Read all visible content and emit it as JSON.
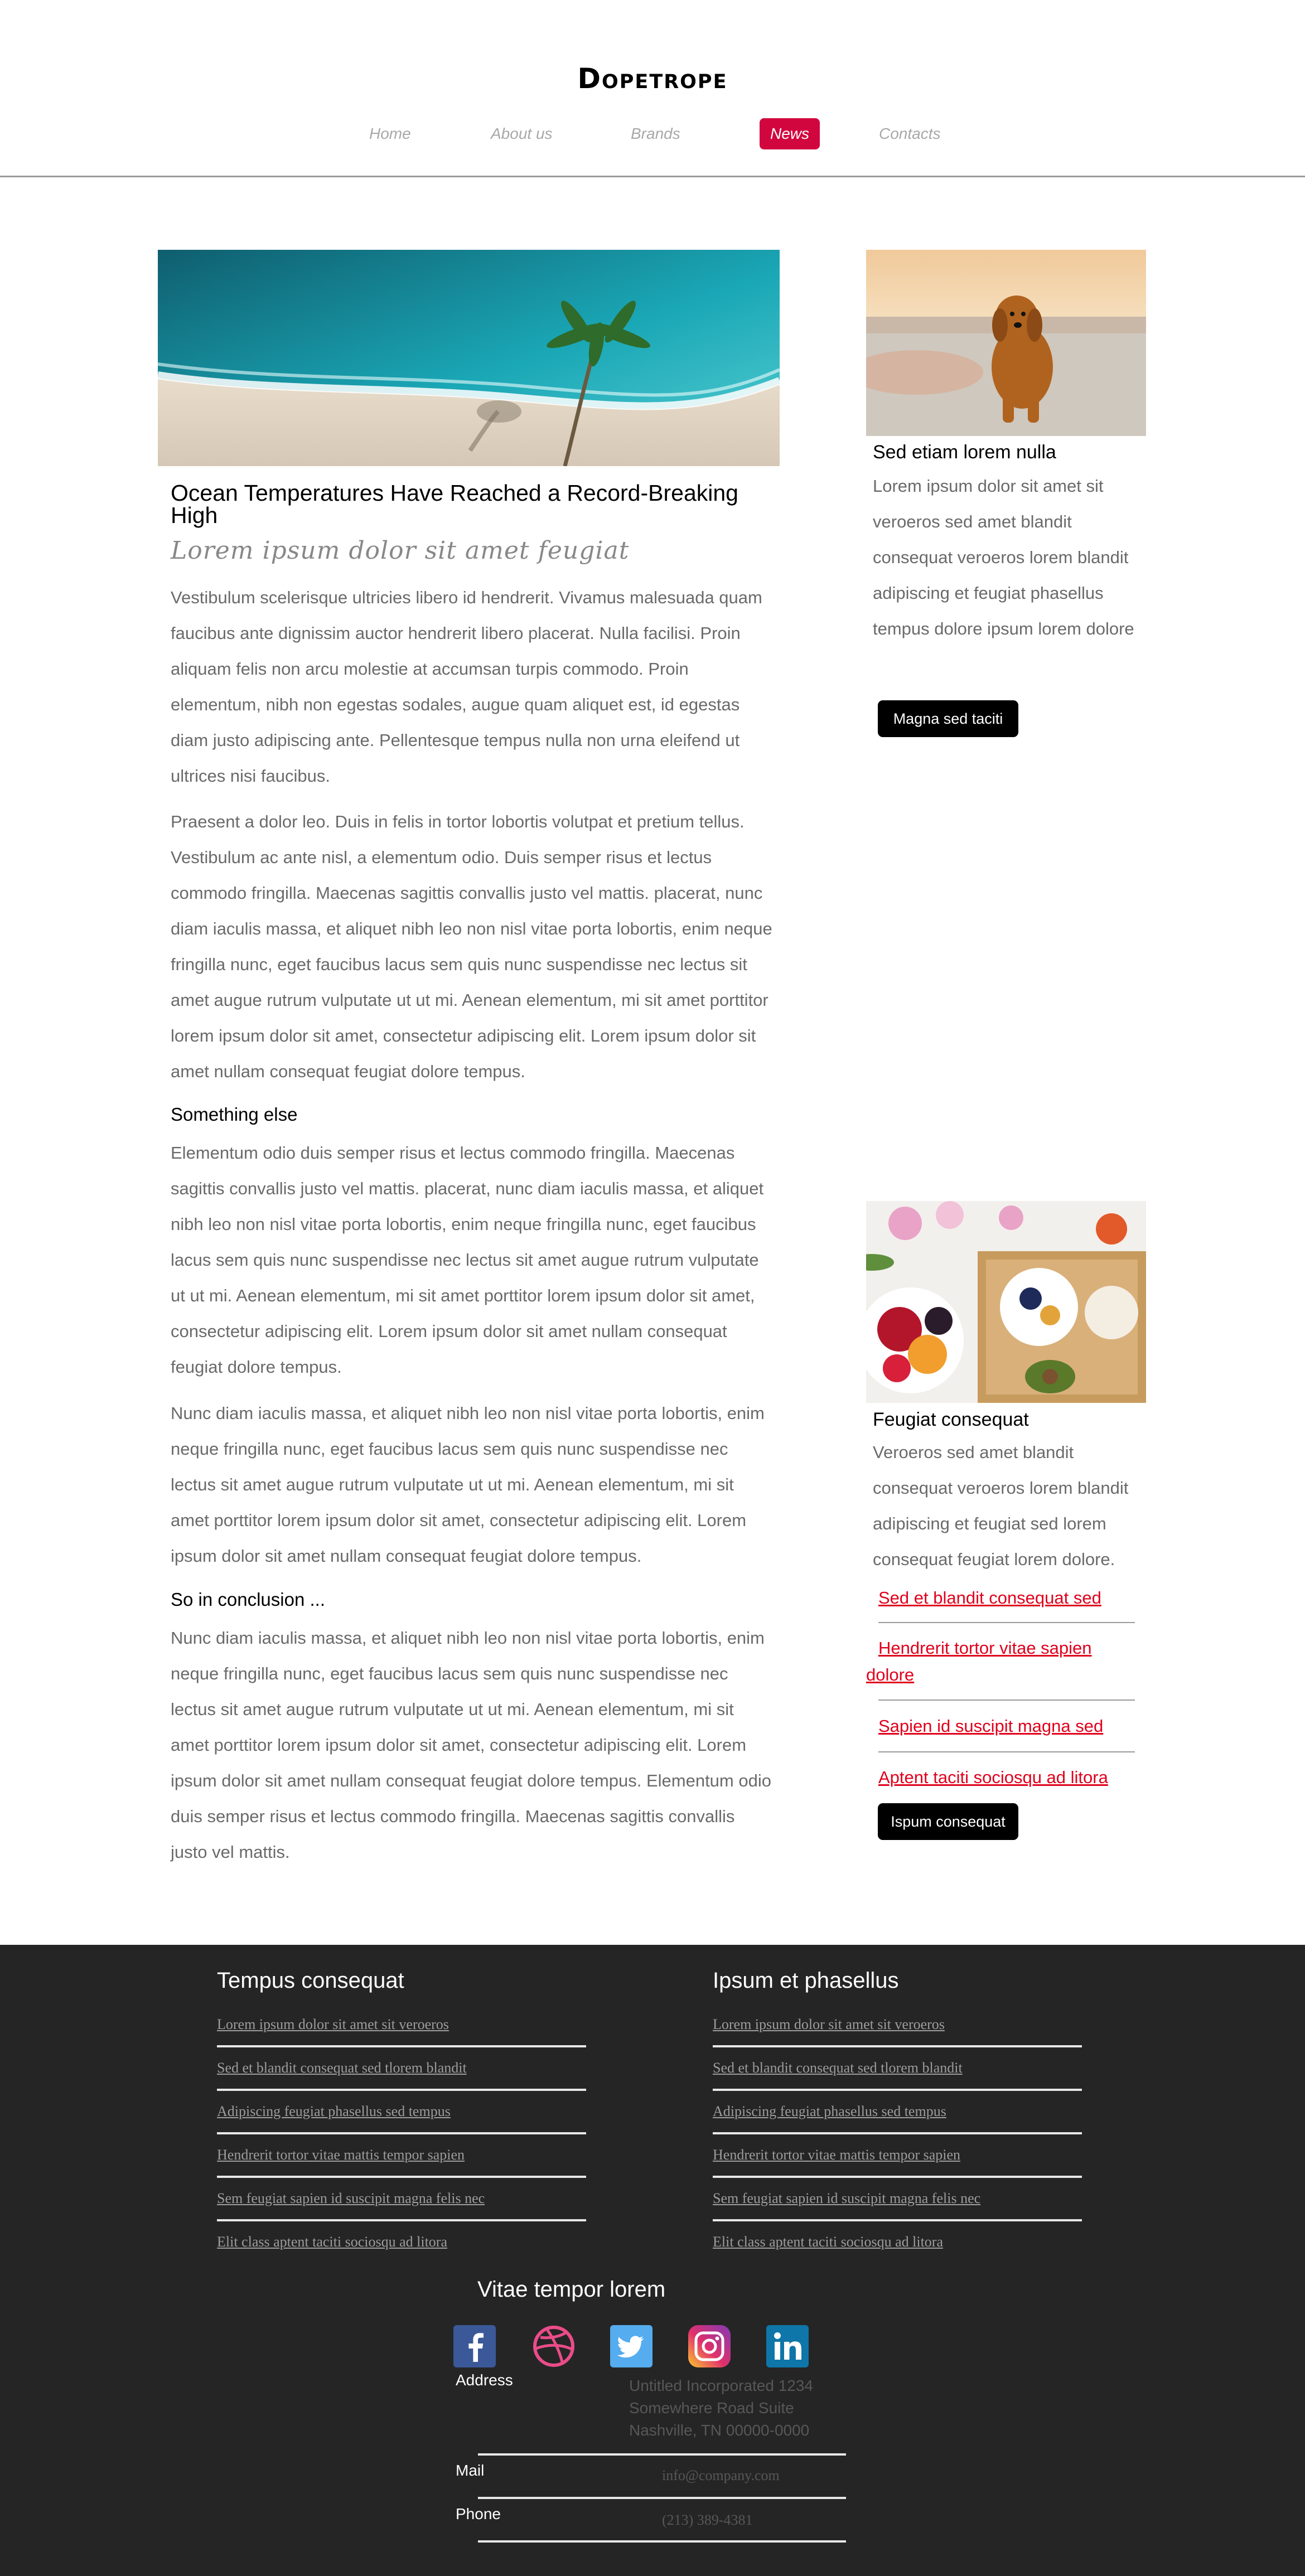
{
  "header": {
    "logo": "Dopetrope",
    "nav": [
      "Home",
      "About us",
      "Brands",
      "News",
      "Contacts"
    ],
    "active_color": "#d2063f"
  },
  "main": {
    "title": "Ocean Temperatures Have Reached a Record-Breaking High",
    "subtitle": "Lorem ipsum dolor sit amet feugiat",
    "paragraphs": [
      "Vestibulum scelerisque ultricies libero id hendrerit. Vivamus malesuada quam faucibus ante dignissim auctor hendrerit libero placerat. Nulla facilisi. Proin aliquam felis non arcu molestie at accumsan turpis commodo. Proin elementum, nibh non egestas sodales, augue quam aliquet est, id egestas diam justo adipiscing ante. Pellentesque tempus nulla non urna eleifend ut ultrices nisi faucibus.",
      "Praesent a dolor leo. Duis in felis in tortor lobortis volutpat et pretium tellus. Vestibulum ac ante nisl, a elementum odio. Duis semper risus et lectus commodo fringilla. Maecenas sagittis convallis justo vel mattis. placerat, nunc diam iaculis massa, et aliquet nibh leo non nisl vitae porta lobortis, enim neque fringilla nunc, eget faucibus lacus sem quis nunc suspendisse nec lectus sit amet augue rutrum vulputate ut ut mi. Aenean elementum, mi sit amet porttitor lorem ipsum dolor sit amet, consectetur adipiscing elit. Lorem ipsum dolor sit amet nullam consequat feugiat dolore tempus."
    ],
    "h_something": "Something else",
    "paragraphs2": [
      "Elementum odio duis semper risus et lectus commodo fringilla. Maecenas sagittis convallis justo vel mattis. placerat, nunc diam iaculis massa, et aliquet nibh leo non nisl vitae porta lobortis, enim neque fringilla nunc, eget faucibus lacus sem quis nunc suspendisse nec lectus sit amet augue rutrum vulputate ut ut mi. Aenean elementum, mi sit amet porttitor lorem ipsum dolor sit amet, consectetur adipiscing elit. Lorem ipsum dolor sit amet nullam consequat feugiat dolore tempus.",
      "Nunc diam iaculis massa, et aliquet nibh leo non nisl vitae porta lobortis, enim neque fringilla nunc, eget faucibus lacus sem quis nunc suspendisse nec lectus sit amet augue rutrum vulputate ut ut mi. Aenean elementum, mi sit amet porttitor lorem ipsum dolor sit amet, consectetur adipiscing elit. Lorem ipsum dolor sit amet nullam consequat feugiat dolore tempus."
    ],
    "h_conclusion": "So in conclusion ...",
    "paragraph3": "Nunc diam iaculis massa, et aliquet nibh leo non nisl vitae porta lobortis, enim neque fringilla nunc, eget faucibus lacus sem quis nunc suspendisse nec lectus sit amet augue rutrum vulputate ut ut mi. Aenean elementum, mi sit amet porttitor lorem ipsum dolor sit amet, consectetur adipiscing elit. Lorem ipsum dolor sit amet nullam consequat feugiat dolore tempus. Elementum odio duis semper risus et lectus commodo fringilla. Maecenas sagittis convallis justo vel mattis."
  },
  "sidebar": {
    "card1": {
      "title": "Sed etiam lorem nulla",
      "text": "Lorem ipsum dolor sit amet sit veroeros sed amet blandit consequat veroeros lorem blandit adipiscing et feugiat phasellus tempus dolore ipsum lorem dolore",
      "button": "Magna sed taciti"
    },
    "card2": {
      "title": "Feugiat consequat",
      "text": "Veroeros sed amet blandit consequat veroeros lorem blandit adipiscing et feugiat sed lorem consequat feugiat lorem dolore.",
      "links": [
        "Sed et blandit consequat sed",
        "Hendrerit tortor vitae sapien dolore",
        "Sapien id suscipit magna sed",
        "Aptent taciti sociosqu ad litora"
      ],
      "button": "Ispum consequat"
    }
  },
  "footer": {
    "col1": {
      "heading": "Tempus consequat",
      "links": [
        "Lorem ipsum dolor sit amet sit veroeros",
        "Sed et blandit consequat sed tlorem blandit",
        "Adipiscing feugiat phasellus sed tempus",
        "Hendrerit tortor vitae mattis tempor sapien",
        "Sem feugiat sapien id suscipit magna felis nec",
        "Elit class aptent taciti sociosqu ad litora"
      ]
    },
    "col2": {
      "heading": "Ipsum et phasellus",
      "links": [
        "Lorem ipsum dolor sit amet sit veroeros",
        "Sed et blandit consequat sed tlorem blandit",
        "Adipiscing feugiat phasellus sed tempus",
        "Hendrerit tortor vitae mattis tempor sapien",
        "Sem feugiat sapien id suscipit magna felis nec",
        "Elit class aptent taciti sociosqu ad litora"
      ]
    },
    "contact": {
      "heading": "Vitae tempor lorem",
      "social_icons": [
        "facebook-icon",
        "dribbble-icon",
        "twitter-icon",
        "instagram-icon",
        "linkedin-icon"
      ],
      "address_label": "Address",
      "address_lines": [
        "Untitled Incorporated 1234",
        "Somewhere Road Suite",
        "Nashville, TN 00000-0000"
      ],
      "mail_label": "Mail",
      "mail_value": "info@company.com",
      "phone_label": "Phone",
      "phone_value": "(213) 389-4381"
    }
  }
}
